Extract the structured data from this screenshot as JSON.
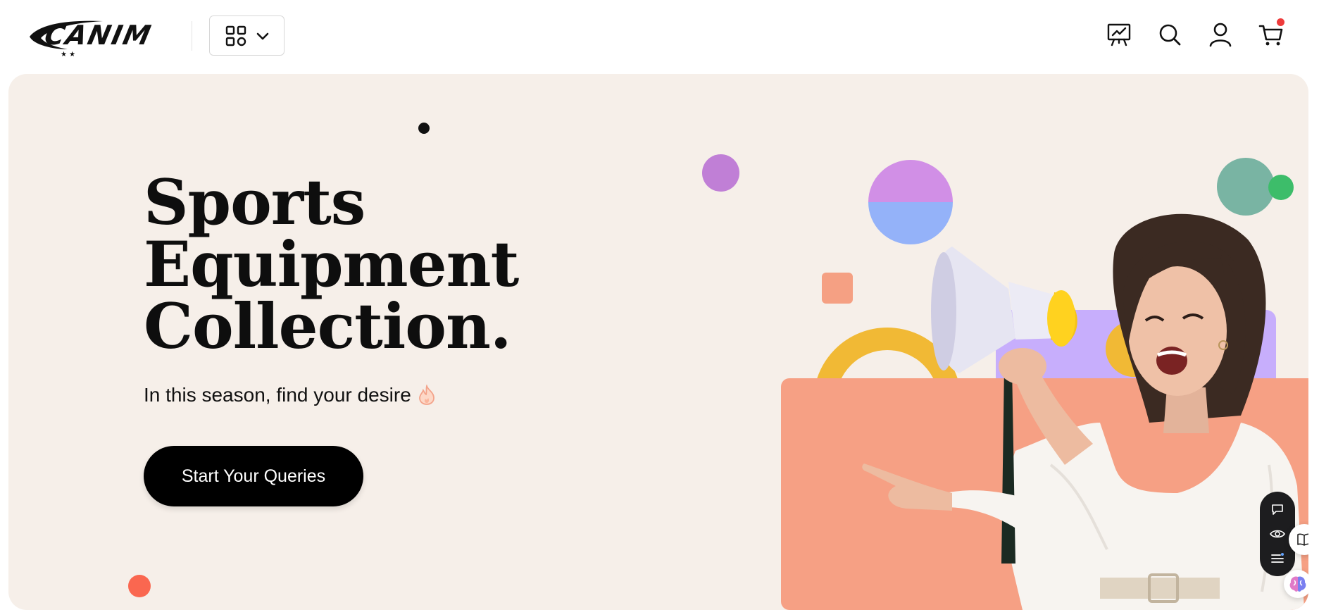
{
  "header": {
    "logo_text": "CANIM",
    "category_button": {
      "grid_icon": "grid-icon",
      "chevron_icon": "chevron-down-icon"
    },
    "icons": [
      "presentation-chart-icon",
      "search-icon",
      "user-icon",
      "cart-icon"
    ],
    "cart_has_notification": true
  },
  "hero": {
    "title_lines": [
      "Sports",
      "Equipment",
      "Collection."
    ],
    "subtitle": "In this season, find your desire",
    "subtitle_icon": "fire-icon",
    "cta_label": "Start Your Queries"
  },
  "colors": {
    "hero_bg": "#f6efe9",
    "cta_bg": "#000000",
    "salmon": "#f6a084",
    "purple": "#c7aefc",
    "yellow": "#f1b935",
    "teal": "#79b4a3",
    "green": "#3dbd6a",
    "violet": "#c07fd6",
    "coral": "#fa6750",
    "notification": "#ee3b3b"
  },
  "floating_toolbar": {
    "icons": [
      "chat-bubble-icon",
      "eye-icon",
      "list-icon"
    ],
    "side_buttons": [
      "book-icon",
      "brain-icon"
    ]
  }
}
